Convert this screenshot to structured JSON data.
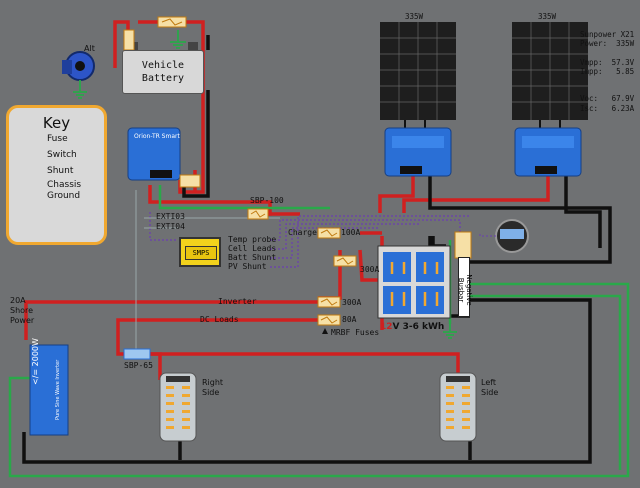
{
  "key": {
    "title": "Key",
    "items": [
      {
        "label": "Fuse",
        "icon": "fuse-icon"
      },
      {
        "label": "Switch",
        "icon": "switch-icon"
      },
      {
        "label": "Shunt",
        "icon": "shunt-icon"
      },
      {
        "label": "Chassis Ground",
        "icon": "chassis-ground-icon"
      }
    ]
  },
  "alternator": {
    "label": "Alt"
  },
  "vehicle_battery": {
    "line1": "Vehicle",
    "line2": "Battery"
  },
  "orion": {
    "label": "Orion-TR Smart"
  },
  "solar": {
    "panel_left": "335W",
    "panel_right": "335W",
    "specs": "Sunpower X21\nPower:  335W\n\nVmpp:  57.3V\nImpp:   5.85\n\n\nVoc:   67.9V\nIsc:   6.23A"
  },
  "labels": {
    "sbp100": "SBP-100",
    "exti03": "EXTI03",
    "exti04": "EXTI04",
    "temp_probe": "Temp probe",
    "cell_leads": "Cell Leads",
    "batt_shunt": "Batt Shunt",
    "pv_shunt": "PV Shunt",
    "charge": "Charge",
    "fuse_100a": "100A",
    "fuse_300a_left": "300A",
    "fuse_300a": "300A",
    "fuse_80a": "80A",
    "inverter": "Inverter",
    "dc_loads": "DC Loads",
    "mrbf": "MRBF Fuses",
    "shore": "20A\nShore\nPower",
    "sbp65": "SBP-65",
    "right_side": "Right\nSide",
    "left_side": "Left\nSide",
    "negative_busbar": "Negative Busbar",
    "smps": "SMPS",
    "battery_bank_voltage": "12",
    "battery_bank_rest": "V 3-6 kWh",
    "inverter_text": "</= 2000W",
    "inverter_brand": "Pure Sine Wave Inverter"
  },
  "colors": {
    "background": "#6f7173",
    "wire_red": "#d02020",
    "wire_black": "#101010",
    "wire_green": "#2aa84a",
    "victron_blue": "#2a6fd6",
    "fuse_orange": "#f0a830"
  }
}
